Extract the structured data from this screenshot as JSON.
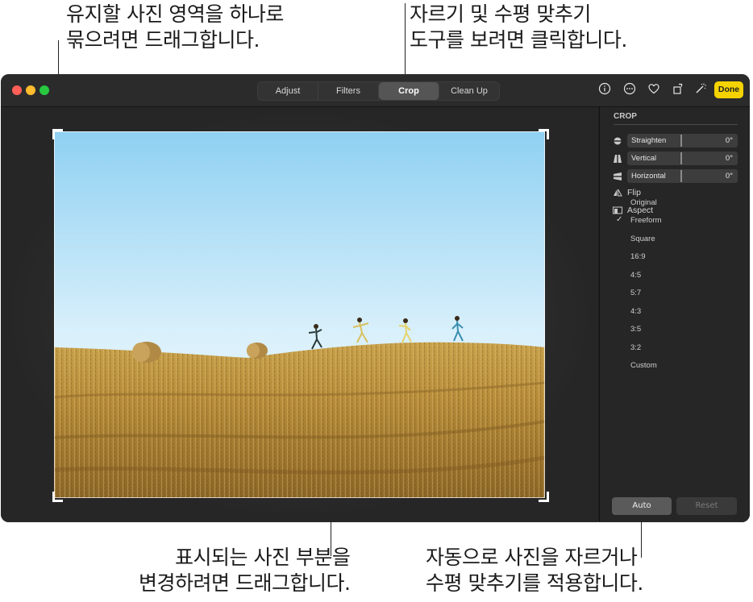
{
  "callouts": {
    "top_left": [
      "유지할 사진 영역을 하나로",
      "묶으려면 드래그합니다."
    ],
    "top_right": [
      "자르기 및 수평 맞추기",
      "도구를 보려면 클릭합니다."
    ],
    "bottom_left": [
      "표시되는 사진 부분을",
      "변경하려면 드래그합니다."
    ],
    "bottom_right": [
      "자동으로 사진을 자르거나",
      "수평 맞추기를 적용합니다."
    ]
  },
  "toolbar": {
    "tabs": [
      "Adjust",
      "Filters",
      "Crop",
      "Clean Up"
    ],
    "active_tab": "Crop",
    "icons": [
      "info-icon",
      "more-icon",
      "heart-icon",
      "rotate-icon",
      "magic-wand-icon"
    ],
    "done_label": "Done"
  },
  "sidebar": {
    "heading": "CROP",
    "sliders": [
      {
        "label": "Straighten",
        "value": "0°",
        "icon": "straighten-icon"
      },
      {
        "label": "Vertical",
        "value": "0°",
        "icon": "vertical-icon"
      },
      {
        "label": "Horizontal",
        "value": "0°",
        "icon": "horizontal-icon"
      }
    ],
    "flip_label": "Flip",
    "aspect_label": "Aspect",
    "aspect_options": [
      "Original",
      "Freeform",
      "Square",
      "16:9",
      "4:5",
      "5:7",
      "4:3",
      "3:5",
      "3:2",
      "Custom"
    ],
    "aspect_selected": "Freeform",
    "auto_label": "Auto",
    "reset_label": "Reset"
  },
  "colors": {
    "done_button": "#f5d300",
    "close": "#ff5f57",
    "minimize": "#febc2e",
    "zoom": "#28c840"
  }
}
